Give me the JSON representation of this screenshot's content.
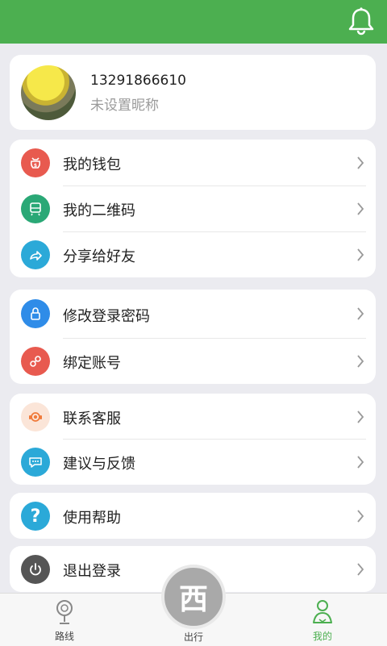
{
  "profile": {
    "phone": "13291866610",
    "nickname": "未设置昵称"
  },
  "groups": [
    [
      {
        "id": "wallet",
        "label": "我的钱包",
        "icon": "wallet-icon",
        "color": "#e85a4f"
      },
      {
        "id": "qrcode",
        "label": "我的二维码",
        "icon": "qrcode-icon",
        "color": "#2aa876"
      },
      {
        "id": "share",
        "label": "分享给好友",
        "icon": "share-icon",
        "color": "#2ba9d8"
      }
    ],
    [
      {
        "id": "password",
        "label": "修改登录密码",
        "icon": "lock-icon",
        "color": "#2f8ce8"
      },
      {
        "id": "bind",
        "label": "绑定账号",
        "icon": "link-icon",
        "color": "#e85a4f"
      }
    ],
    [
      {
        "id": "service",
        "label": "联系客服",
        "icon": "headset-icon",
        "color": "#f07a3a"
      },
      {
        "id": "feedback",
        "label": "建议与反馈",
        "icon": "chat-bubble-icon",
        "color": "#2ba9d8"
      }
    ],
    [
      {
        "id": "help",
        "label": "使用帮助",
        "icon": "question-icon",
        "color": "#2ba9d8"
      }
    ],
    [
      {
        "id": "logout",
        "label": "退出登录",
        "icon": "power-icon",
        "color": "#555555"
      }
    ]
  ],
  "tabs": {
    "routes": "路线",
    "travel": "出行",
    "mine": "我的"
  },
  "fab": {
    "glyph": "西"
  },
  "colors": {
    "brand": "#4caf50",
    "active_tab": "#4caf50"
  }
}
